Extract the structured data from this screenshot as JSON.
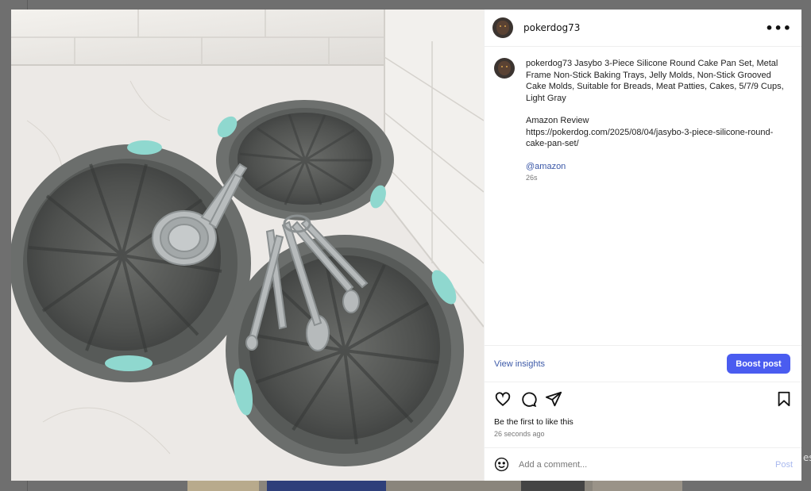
{
  "backdrop": {
    "edge_text": "es"
  },
  "post": {
    "username": "pokerdog73",
    "more_icon": "more-horizontal-icon",
    "caption": {
      "username": "pokerdog73",
      "text": "Jasybo 3-Piece Silicone Round Cake Pan Set, Metal Frame Non-Stick Baking Trays, Jelly Molds, Non-Stick Grooved Cake Molds, Suitable for Breads, Meat Patties, Cakes, 5/7/9 Cups, Light Gray",
      "review_label": "Amazon Review",
      "review_url": "https://pokerdog.com/2025/08/04/jasybo-3-piece-silicone-round-cake-pan-set/",
      "mention": "@amazon",
      "time": "26s"
    },
    "insights": {
      "view_label": "View insights",
      "boost_label": "Boost post"
    },
    "actions": [
      "heart-icon",
      "comment-icon",
      "share-icon",
      "bookmark-icon"
    ],
    "likes_text": "Be the first to like this",
    "posted_ago": "26 seconds ago",
    "comment": {
      "placeholder": "Add a comment...",
      "post_label": "Post"
    }
  },
  "colors": {
    "accent": "#4a5cf0",
    "link": "#3d5aa8",
    "post_disabled": "#a9b9ef",
    "mold_teal": "#8fd8cf",
    "mold_gray": "#5d605e"
  }
}
